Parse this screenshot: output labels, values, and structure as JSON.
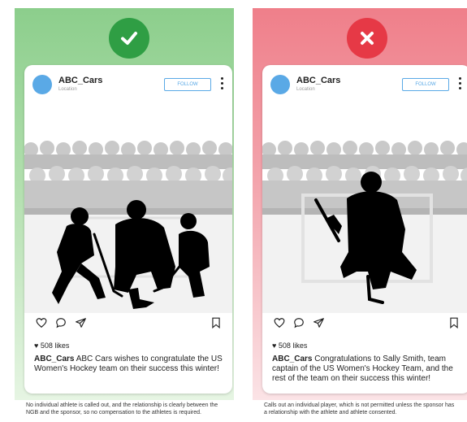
{
  "colors": {
    "approve_green": "#2f9e44",
    "reject_red": "#e63946",
    "follow_blue": "#5aa9e6"
  },
  "left": {
    "badge_icon": "check-icon",
    "post": {
      "username": "ABC_Cars",
      "location": "Location",
      "follow_label": "FOLLOW",
      "likes": "508 likes",
      "caption_user": "ABC_Cars",
      "caption_text": "ABC Cars wishes to congratulate the US Women's Hockey team on their success this winter!"
    },
    "note": "No individual athlete is called out, and the relationship is clearly between the NGB and the sponsor, so no compensation to the athletes is required."
  },
  "right": {
    "badge_icon": "cross-icon",
    "post": {
      "username": "ABC_Cars",
      "location": "Location",
      "follow_label": "FOLLOW",
      "likes": "508 likes",
      "caption_user": "ABC_Cars",
      "caption_text": "Congratulations to Sally Smith, team captain of the US Women's Hockey Team, and the rest of the team on their success this winter!"
    },
    "note": "Calls out an individual player, which is not permitted unless the sponsor has a relationship with the athlete and athlete consented."
  }
}
